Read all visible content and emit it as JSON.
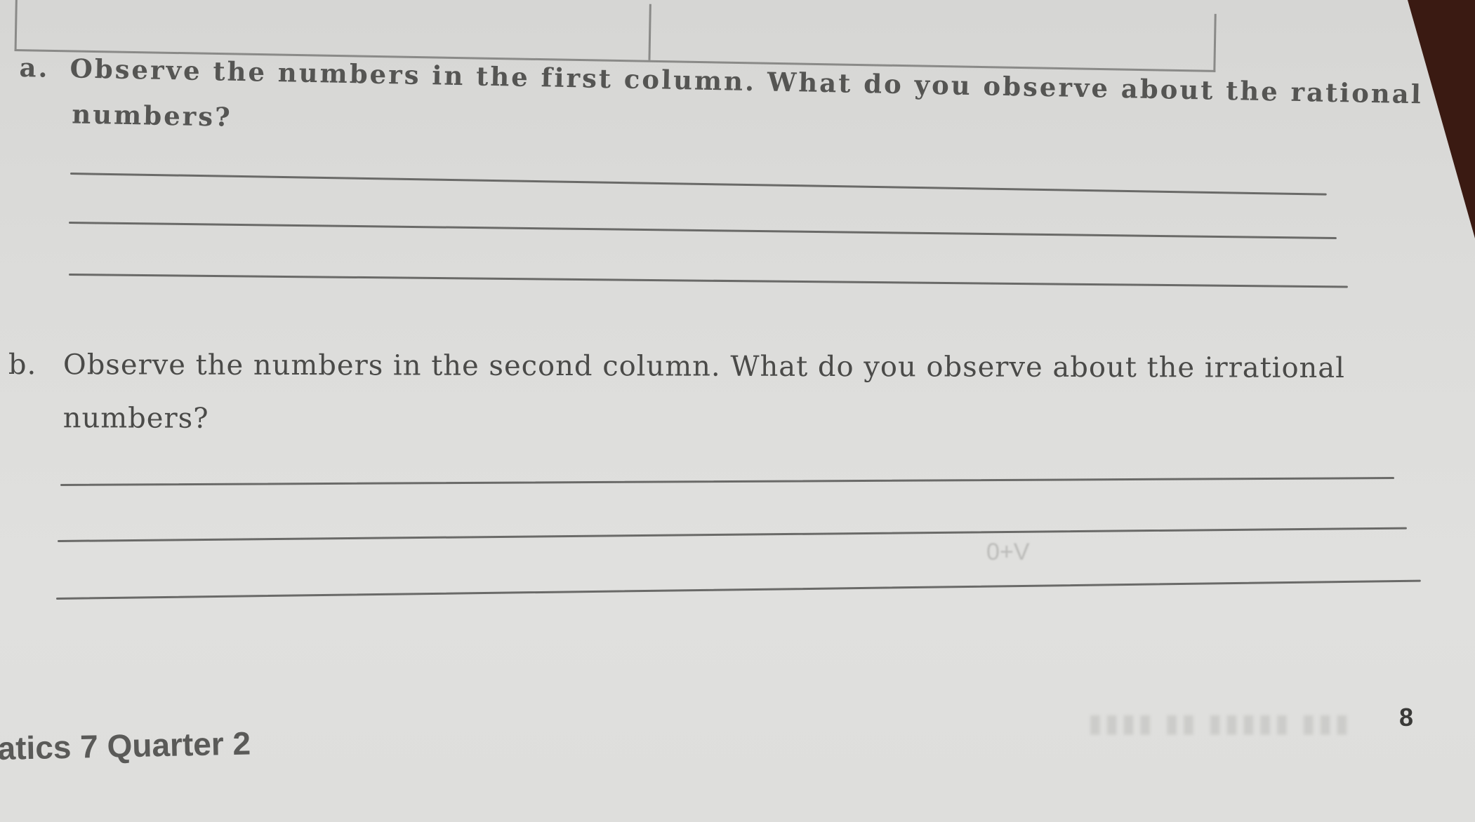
{
  "document": {
    "questions": [
      {
        "label": "a.",
        "text_line1": "Observe the numbers in the first column. What do you observe about the rational",
        "text_line2": "numbers?",
        "answer_lines": 3
      },
      {
        "label": "b.",
        "text_line1": "Observe the numbers in the second column. What do you observe about the irrational",
        "text_line2": "numbers?",
        "answer_lines": 3
      }
    ],
    "footer": {
      "title": "atics 7 Quarter 2",
      "page_number": "8"
    },
    "bleed_through": {
      "smudge_text": "0+V"
    }
  },
  "colors": {
    "paper": "#dcdcda",
    "ink": "#4a4a48",
    "background": "#3a1a12"
  }
}
